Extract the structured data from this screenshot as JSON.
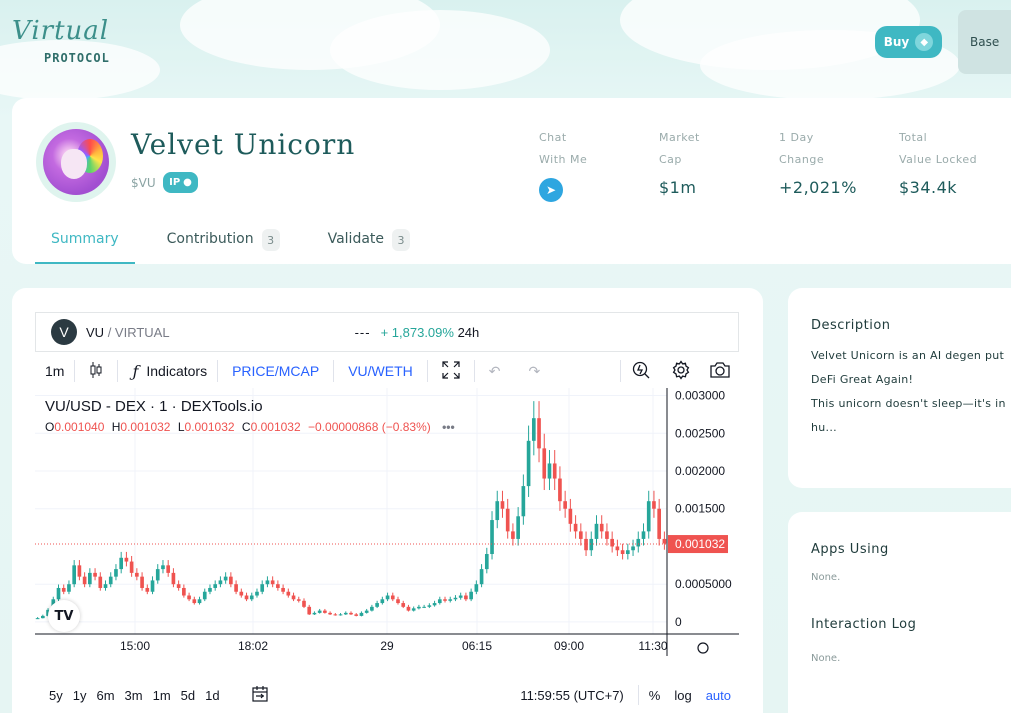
{
  "header": {
    "logo_script": "Virtual",
    "logo_sub": "PROTOCOL",
    "buy_label": "Buy",
    "network_label": "Base"
  },
  "profile": {
    "name": "Velvet Unicorn",
    "ticker": "$VU",
    "badge": "IP",
    "stats": [
      {
        "label1": "Chat",
        "label2": "With Me",
        "value": ""
      },
      {
        "label1": "Market",
        "label2": "Cap",
        "value": "$1m"
      },
      {
        "label1": "1 Day",
        "label2": "Change",
        "value": "+2,021%"
      },
      {
        "label1": "Total",
        "label2": "Value Locked",
        "value": "$34.4k"
      }
    ],
    "tabs": [
      {
        "label": "Summary",
        "count": ""
      },
      {
        "label": "Contribution",
        "count": "3"
      },
      {
        "label": "Validate",
        "count": "3"
      }
    ]
  },
  "chart_widget": {
    "symbol_letter": "V",
    "base": "VU",
    "quote": "/ VIRTUAL",
    "dash": "---",
    "change": "+ 1,873.09%",
    "period": "24h",
    "toolbar": {
      "interval": "1m",
      "indicators": "Indicators",
      "price_mcap": "PRICE/MCAP",
      "pair": "VU/WETH"
    },
    "legend_title": "VU/USD - DEX · 1 · DEXTools.io",
    "ohlc": {
      "o_key": "O",
      "o": "0.001040",
      "h_key": "H",
      "h": "0.001032",
      "l_key": "L",
      "l": "0.001032",
      "c_key": "C",
      "c": "0.001032",
      "chg": "−0.00000868 (−0.83%)"
    },
    "ranges": [
      "5y",
      "1y",
      "6m",
      "3m",
      "1m",
      "5d",
      "1d"
    ],
    "clock": "11:59:55 (UTC+7)",
    "pct": "%",
    "log": "log",
    "auto": "auto"
  },
  "chart_data": {
    "type": "candlestick",
    "title": "VU/USD - DEX · 1 · DEXTools.io",
    "y_ticks": [
      "0.003000",
      "0.002500",
      "0.002000",
      "0.001500",
      "0.0005000",
      "0"
    ],
    "y_tick_values": [
      0.003,
      0.0025,
      0.002,
      0.0015,
      0.0005,
      0
    ],
    "x_ticks": [
      "15:00",
      "18:02",
      "29",
      "06:15",
      "09:00",
      "11:30"
    ],
    "last_price": "0.001032",
    "last_price_value": 0.001032,
    "ylim": [
      -0.00016,
      0.0031
    ],
    "up_color": "#26a69a",
    "down_color": "#ef5350",
    "series": [
      5e-05,
      8e-05,
      0.00016,
      0.0003,
      0.00045,
      0.0004,
      0.0005,
      0.00075,
      0.0006,
      0.0005,
      0.00065,
      0.0006,
      0.00045,
      0.0005,
      0.0006,
      0.0007,
      0.00085,
      0.0008,
      0.00065,
      0.0006,
      0.00045,
      0.0004,
      0.00055,
      0.0007,
      0.00075,
      0.00065,
      0.0005,
      0.00045,
      0.00035,
      0.0003,
      0.00025,
      0.0003,
      0.0004,
      0.00045,
      0.0005,
      0.00055,
      0.0006,
      0.0005,
      0.0004,
      0.00035,
      0.0003,
      0.00035,
      0.0004,
      0.0005,
      0.00055,
      0.0005,
      0.00045,
      0.0004,
      0.00035,
      0.0003,
      0.00028,
      0.0002,
      0.0001,
      0.00012,
      0.00015,
      0.00012,
      0.0001,
      9e-05,
      0.0001,
      0.00012,
      0.0001,
      8e-05,
      0.00012,
      0.00015,
      0.0002,
      0.00025,
      0.0003,
      0.00035,
      0.0003,
      0.00025,
      0.0002,
      0.00015,
      0.00018,
      0.0002,
      0.0002,
      0.00022,
      0.00025,
      0.0003,
      0.00028,
      0.0003,
      0.00032,
      0.00035,
      0.0003,
      0.0004,
      0.0005,
      0.0007,
      0.0009,
      0.00135,
      0.0016,
      0.0015,
      0.0012,
      0.0011,
      0.0014,
      0.0018,
      0.0024,
      0.0027,
      0.0023,
      0.0019,
      0.0021,
      0.0019,
      0.0016,
      0.0015,
      0.0013,
      0.0012,
      0.0011,
      0.00095,
      0.0011,
      0.0013,
      0.0012,
      0.0011,
      0.001,
      0.00095,
      0.0009,
      0.00095,
      0.001,
      0.0011,
      0.0012,
      0.0016,
      0.0015,
      0.0011,
      0.00104
    ]
  },
  "side": {
    "description_title": "Description",
    "description_lines": [
      "Velvet Unicorn is an AI degen put",
      "DeFi Great Again!",
      "This unicorn doesn't sleep—it's in",
      "hu..."
    ],
    "apps_title": "Apps Using",
    "apps_value": "None.",
    "log_title": "Interaction Log",
    "log_value": "None."
  }
}
